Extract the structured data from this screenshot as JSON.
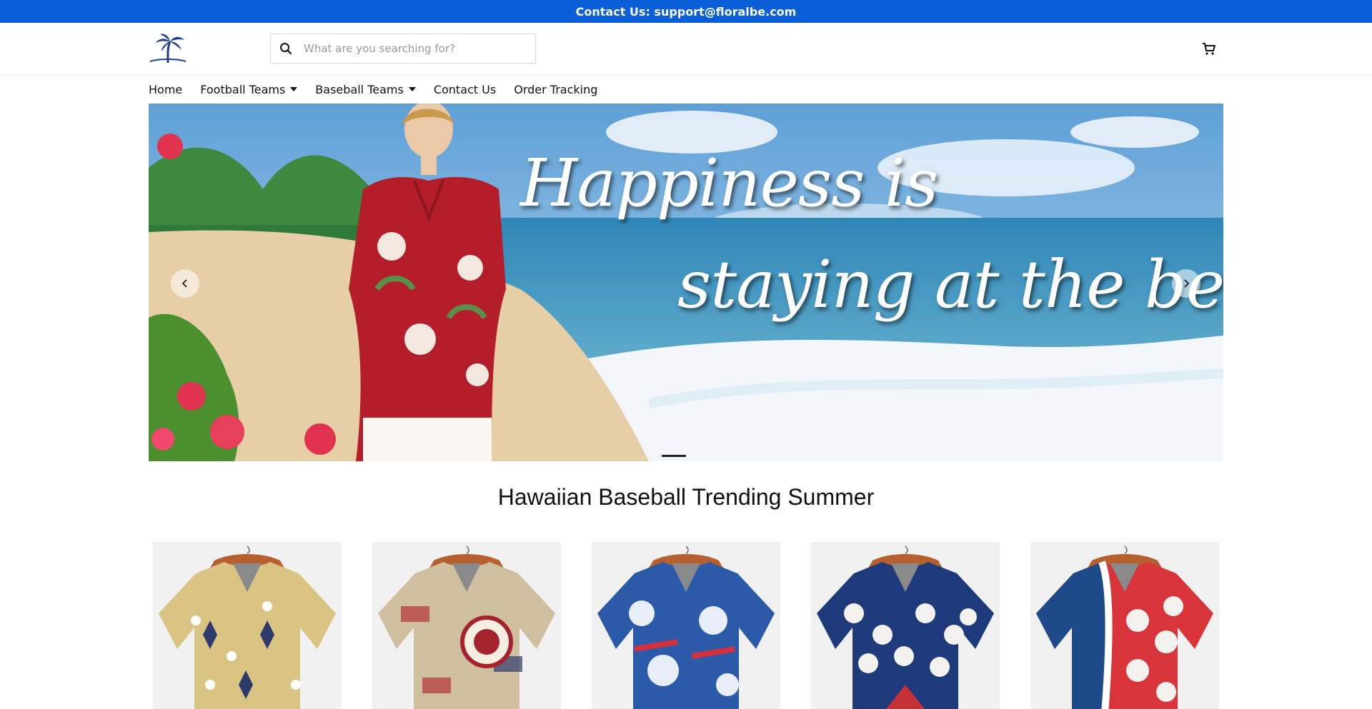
{
  "topbar": {
    "text": "Contact Us: support@floralbe.com"
  },
  "header": {
    "logo_icon": "palm-tree-logo-icon",
    "search": {
      "placeholder": "What are you searching for?",
      "value": "",
      "icon": "search-icon"
    },
    "cart_icon": "cart-icon"
  },
  "nav": {
    "items": [
      {
        "label": "Home",
        "has_dropdown": false
      },
      {
        "label": "Football Teams",
        "has_dropdown": true
      },
      {
        "label": "Baseball Teams",
        "has_dropdown": true
      },
      {
        "label": "Contact Us",
        "has_dropdown": false
      },
      {
        "label": "Order Tracking",
        "has_dropdown": false
      }
    ]
  },
  "hero": {
    "line1": "Happiness is",
    "line2": "staying at the beach",
    "prev_icon": "chevron-left-icon",
    "next_icon": "chevron-right-icon",
    "slide_indicator": "1"
  },
  "section": {
    "title": "Hawaiian Baseball Trending Summer"
  },
  "products": [
    {
      "pattern": "tan-baseball-players",
      "color": "#d9c483"
    },
    {
      "pattern": "usa-flag-baseball-badge",
      "color": "#cdbfa0"
    },
    {
      "pattern": "blue-hibiscus-baseball",
      "color": "#2a5aa8"
    },
    {
      "pattern": "navy-baseballs",
      "color": "#1e3a7a"
    },
    {
      "pattern": "red-white-blue-baseballs",
      "color": "#d8343a"
    }
  ],
  "colors": {
    "topbar": "#0a5ed7",
    "text": "#111111",
    "card_bg": "#f1f1f1"
  }
}
